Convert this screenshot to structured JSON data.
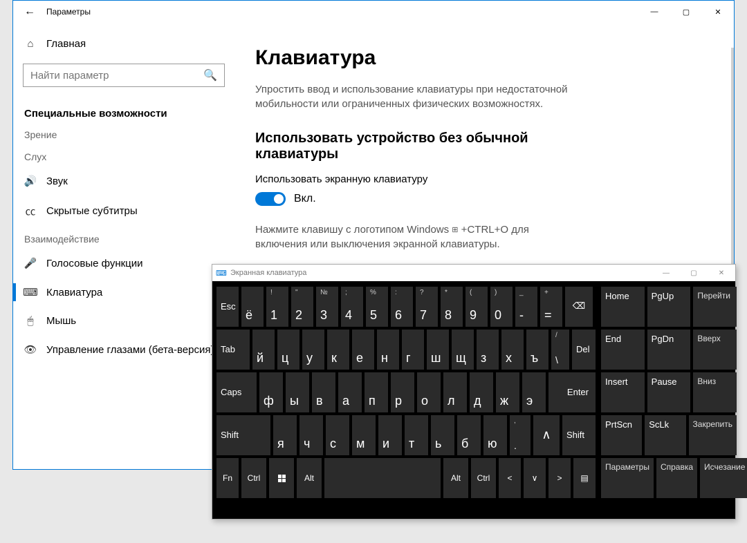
{
  "settings": {
    "title": "Параметры",
    "home": "Главная",
    "search_placeholder": "Найти параметр",
    "section": "Специальные возможности",
    "groups": {
      "vision": "Зрение",
      "hearing": "Слух",
      "interaction": "Взаимодействие"
    },
    "nav": {
      "sound": "Звук",
      "captions": "Скрытые субтитры",
      "speech": "Голосовые функции",
      "keyboard": "Клавиатура",
      "mouse": "Мышь",
      "eye": "Управление глазами (бета-версия)"
    }
  },
  "main": {
    "h1": "Клавиатура",
    "desc": "Упростить ввод и использование клавиатуры при недостаточной мобильности или ограниченных физических возможностях.",
    "h2": "Использовать устройство без обычной клавиатуры",
    "toggle_label": "Использовать экранную клавиатуру",
    "toggle_state": "Вкл.",
    "hint_pre": "Нажмите клавишу с логотипом Windows ",
    "hint_post": " +CTRL+O для включения или выключения экранной клавиатуры."
  },
  "osk": {
    "title": "Экранная клавиатура",
    "row1": {
      "esc": "Esc",
      "yo": "ё",
      "nums": [
        "1",
        "2",
        "3",
        "4",
        "5",
        "6",
        "7",
        "8",
        "9",
        "0",
        "-",
        "="
      ],
      "sups": [
        "!",
        "\"",
        "№",
        ";",
        "%",
        ":",
        "?",
        "*",
        "(",
        ")",
        "_",
        "+"
      ]
    },
    "row2": {
      "tab": "Tab",
      "letters": [
        "й",
        "ц",
        "у",
        "к",
        "е",
        "н",
        "г",
        "ш",
        "щ",
        "з",
        "х",
        "ъ"
      ],
      "slash_main": "\\",
      "slash_sup": "/",
      "del": "Del"
    },
    "row3": {
      "caps": "Caps",
      "letters": [
        "ф",
        "ы",
        "в",
        "а",
        "п",
        "р",
        "о",
        "л",
        "д",
        "ж",
        "э"
      ],
      "enter": "Enter"
    },
    "row4": {
      "shift_l": "Shift",
      "letters": [
        "я",
        "ч",
        "с",
        "м",
        "и",
        "т",
        "ь",
        "б",
        "ю"
      ],
      "dot_main": ".",
      "dot_sup": ",",
      "up": "∧",
      "shift_r": "Shift"
    },
    "row5": {
      "fn": "Fn",
      "ctrl_l": "Ctrl",
      "alt_l": "Alt",
      "alt_r": "Alt",
      "ctrl_r": "Ctrl",
      "left": "<",
      "down": "∨",
      "right": ">"
    },
    "side": {
      "home": "Home",
      "pgup": "PgUp",
      "go": "Перейти",
      "end": "End",
      "pgdn": "PgDn",
      "up": "Вверх",
      "insert": "Insert",
      "pause": "Pause",
      "down": "Вниз",
      "prtscn": "PrtScn",
      "sclk": "ScLk",
      "pin": "Закрепить",
      "params": "Параметры",
      "help": "Справка",
      "fade": "Исчезание"
    }
  }
}
